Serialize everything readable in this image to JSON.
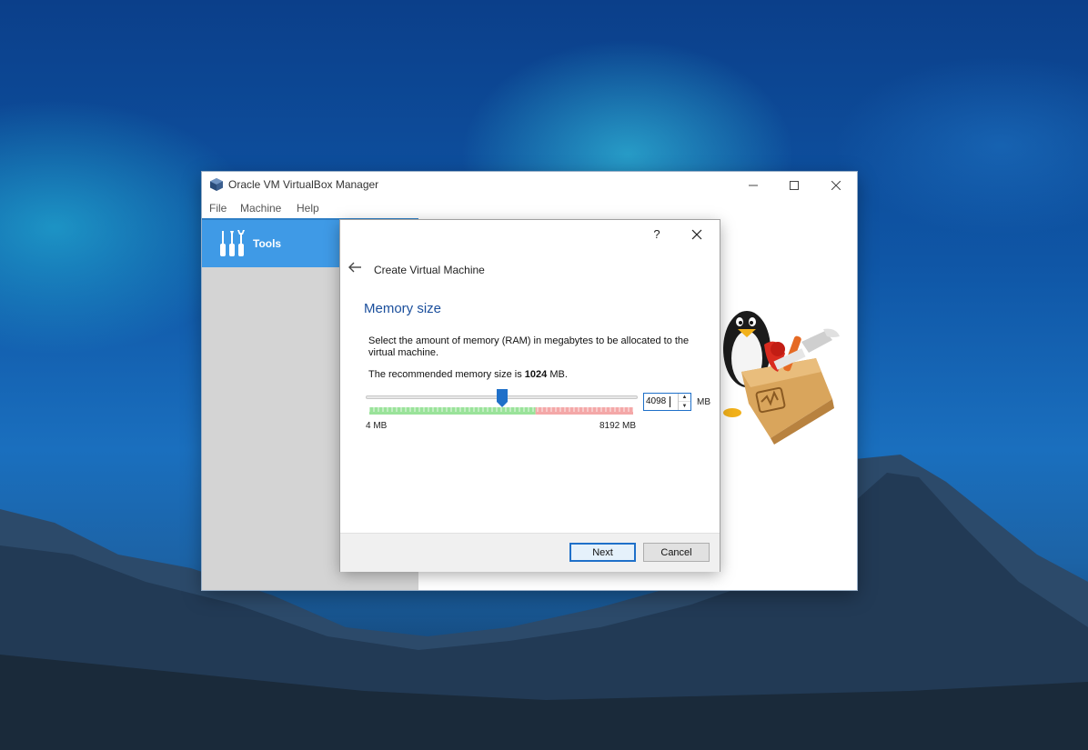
{
  "window": {
    "title": "Oracle VM VirtualBox Manager",
    "controls": {
      "minimize_icon": "minimize-icon",
      "maximize_icon": "maximize-icon",
      "close_icon": "close-icon"
    }
  },
  "menu": {
    "items": [
      "File",
      "Machine",
      "Help"
    ]
  },
  "sidebar": {
    "tools_label": "Tools"
  },
  "dialog": {
    "help_label": "?",
    "title": "Create Virtual Machine",
    "section_title": "Memory size",
    "description": "Select the amount of memory (RAM) in megabytes to be allocated to the virtual machine.",
    "recommend_prefix": "The recommended memory size is ",
    "recommend_value": "1024",
    "recommend_suffix": " MB.",
    "slider": {
      "min_label": "4 MB",
      "max_label": "8192 MB",
      "value": 4098,
      "min": 4,
      "max": 8192,
      "recommended_max_fraction": 0.63
    },
    "spinbox_value": "4098",
    "unit": "MB",
    "buttons": {
      "next": "Next",
      "cancel": "Cancel"
    }
  },
  "colors": {
    "accent": "#3f9ae6",
    "section_title": "#1b4f9c",
    "scale_green": "#9ae39a",
    "scale_red": "#f4a8a8"
  }
}
